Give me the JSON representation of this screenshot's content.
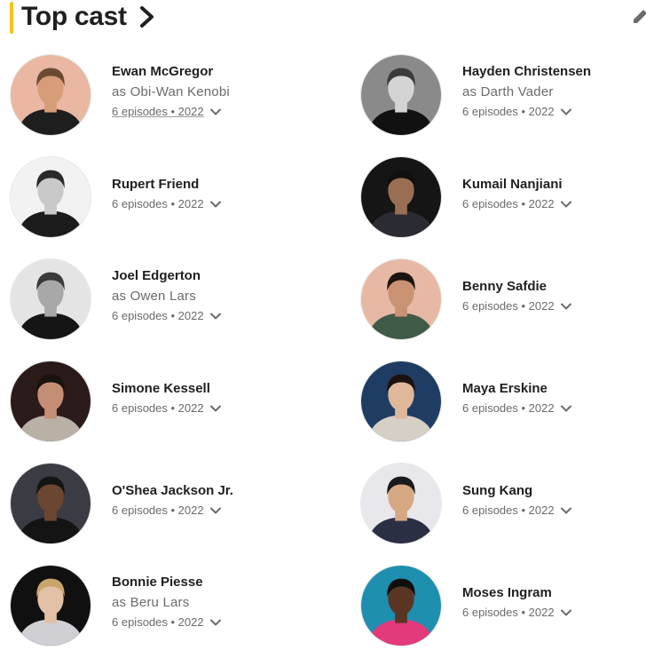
{
  "header": {
    "title": "Top cast"
  },
  "cast": [
    {
      "actor": "Ewan McGregor",
      "role": "as Obi-Wan Kenobi",
      "episodes": "6 episodes • 2022",
      "underlined": true,
      "avatar_bg": "#e9b7a2",
      "skin": "#d79c78",
      "hair": "#6a4a32",
      "suit": "#1e1e1e"
    },
    {
      "actor": "Hayden Christensen",
      "role": "as Darth Vader",
      "episodes": "6 episodes • 2022",
      "underlined": false,
      "avatar_bg": "#8a8a8a",
      "skin": "#d4d4d4",
      "hair": "#3b3b3b",
      "suit": "#111111"
    },
    {
      "actor": "Rupert Friend",
      "role": "",
      "episodes": "6 episodes • 2022",
      "underlined": false,
      "avatar_bg": "#f2f2f2",
      "skin": "#c9c9c9",
      "hair": "#2a2a2a",
      "suit": "#1b1b1b"
    },
    {
      "actor": "Kumail Nanjiani",
      "role": "",
      "episodes": "6 episodes • 2022",
      "underlined": false,
      "avatar_bg": "#151515",
      "skin": "#9a6e52",
      "hair": "#101010",
      "suit": "#2b2b33"
    },
    {
      "actor": "Joel Edgerton",
      "role": "as Owen Lars",
      "episodes": "6 episodes • 2022",
      "underlined": false,
      "avatar_bg": "#e4e4e4",
      "skin": "#a8a8a8",
      "hair": "#3a3a3a",
      "suit": "#151515"
    },
    {
      "actor": "Benny Safdie",
      "role": "",
      "episodes": "6 episodes • 2022",
      "underlined": false,
      "avatar_bg": "#e7b9a4",
      "skin": "#c99272",
      "hair": "#1c1410",
      "suit": "#3f5a46"
    },
    {
      "actor": "Simone Kessell",
      "role": "",
      "episodes": "6 episodes • 2022",
      "underlined": false,
      "avatar_bg": "#2a1a1a",
      "skin": "#c48e74",
      "hair": "#1a120e",
      "suit": "#b9b0a6"
    },
    {
      "actor": "Maya Erskine",
      "role": "",
      "episodes": "6 episodes • 2022",
      "underlined": false,
      "avatar_bg": "#1f3d63",
      "skin": "#dfb89a",
      "hair": "#1a120e",
      "suit": "#d6cfc6"
    },
    {
      "actor": "O'Shea Jackson Jr.",
      "role": "",
      "episodes": "6 episodes • 2022",
      "underlined": false,
      "avatar_bg": "#3b3b44",
      "skin": "#6b4631",
      "hair": "#141414",
      "suit": "#141414"
    },
    {
      "actor": "Sung Kang",
      "role": "",
      "episodes": "6 episodes • 2022",
      "underlined": false,
      "avatar_bg": "#e8e8ec",
      "skin": "#d6a882",
      "hair": "#1a1a1a",
      "suit": "#2a2f44"
    },
    {
      "actor": "Bonnie Piesse",
      "role": "as Beru Lars",
      "episodes": "6 episodes • 2022",
      "underlined": false,
      "avatar_bg": "#101010",
      "skin": "#e2c0a6",
      "hair": "#c9a56a",
      "suit": "#cfcfd4"
    },
    {
      "actor": "Moses Ingram",
      "role": "",
      "episodes": "6 episodes • 2022",
      "underlined": false,
      "avatar_bg": "#1f8fb0",
      "skin": "#5a3524",
      "hair": "#0f0f0f",
      "suit": "#e23a7a"
    }
  ]
}
